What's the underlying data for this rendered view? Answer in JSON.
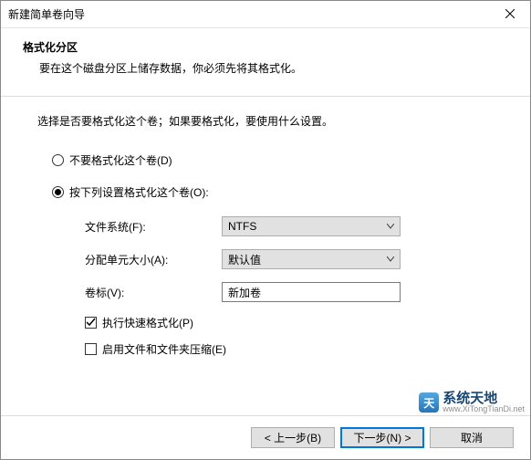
{
  "window": {
    "title": "新建简单卷向导"
  },
  "header": {
    "title": "格式化分区",
    "desc": "要在这个磁盘分区上储存数据，你必须先将其格式化。"
  },
  "content": {
    "instruction": "选择是否要格式化这个卷；如果要格式化，要使用什么设置。",
    "radio_noformat": "不要格式化这个卷(D)",
    "radio_format": "按下列设置格式化这个卷(O):",
    "label_filesystem": "文件系统(F):",
    "value_filesystem": "NTFS",
    "label_allocunit": "分配单元大小(A):",
    "value_allocunit": "默认值",
    "label_vollabel": "卷标(V):",
    "value_vollabel": "新加卷",
    "check_quickfmt": "执行快速格式化(P)",
    "check_compress": "启用文件和文件夹压缩(E)"
  },
  "footer": {
    "back": "< 上一步(B)",
    "next": "下一步(N) >",
    "cancel": "取消"
  },
  "watermark": {
    "cn": "系统天地",
    "en": "www.XiTongTianDi.net"
  }
}
